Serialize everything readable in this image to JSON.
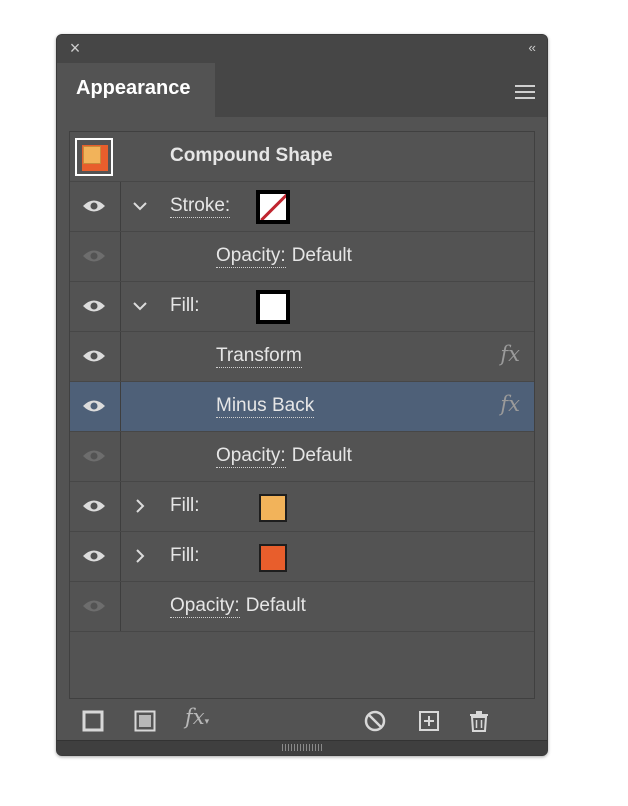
{
  "panel": {
    "tab_title": "Appearance",
    "collapse_glyph": "‹‹",
    "close_glyph": "×"
  },
  "rows": [
    {
      "id": "header",
      "label": "Compound Shape",
      "thumbnail": {
        "back": "#e85e2c",
        "front": "#f2b35a"
      }
    },
    {
      "id": "stroke",
      "label": "Stroke:",
      "eye": "visible",
      "chevron": "expanded",
      "swatch": "none-stroke"
    },
    {
      "id": "stroke-opacity",
      "label": "Opacity:",
      "value": "Default",
      "eye": "dimmed"
    },
    {
      "id": "fill-white",
      "label": "Fill:",
      "eye": "visible",
      "chevron": "expanded",
      "swatch_color": "#ffffff"
    },
    {
      "id": "transform",
      "label": "Transform",
      "eye": "visible",
      "fx": "fx"
    },
    {
      "id": "minus-back",
      "label": "Minus Back",
      "eye": "visible",
      "fx": "fx",
      "selected": true
    },
    {
      "id": "fill-opacity",
      "label": "Opacity:",
      "value": "Default",
      "eye": "dimmed"
    },
    {
      "id": "fill-yellow",
      "label": "Fill:",
      "eye": "visible",
      "chevron": "collapsed",
      "swatch_color": "#f2b35a"
    },
    {
      "id": "fill-orange",
      "label": "Fill:",
      "eye": "visible",
      "chevron": "collapsed",
      "swatch_color": "#e85e2c"
    },
    {
      "id": "opacity",
      "label": "Opacity:",
      "value": "Default",
      "eye": "dimmed"
    }
  ],
  "colors": {
    "panel_bg": "#535353",
    "selected": "#4e6078",
    "text": "#e6e6e6"
  },
  "toolbar": {
    "icons": [
      "add-new-stroke-icon",
      "add-new-fill-icon",
      "add-new-effect-icon",
      "clear-appearance-icon",
      "duplicate-item-icon",
      "delete-item-icon"
    ],
    "fx_label": "fx"
  }
}
